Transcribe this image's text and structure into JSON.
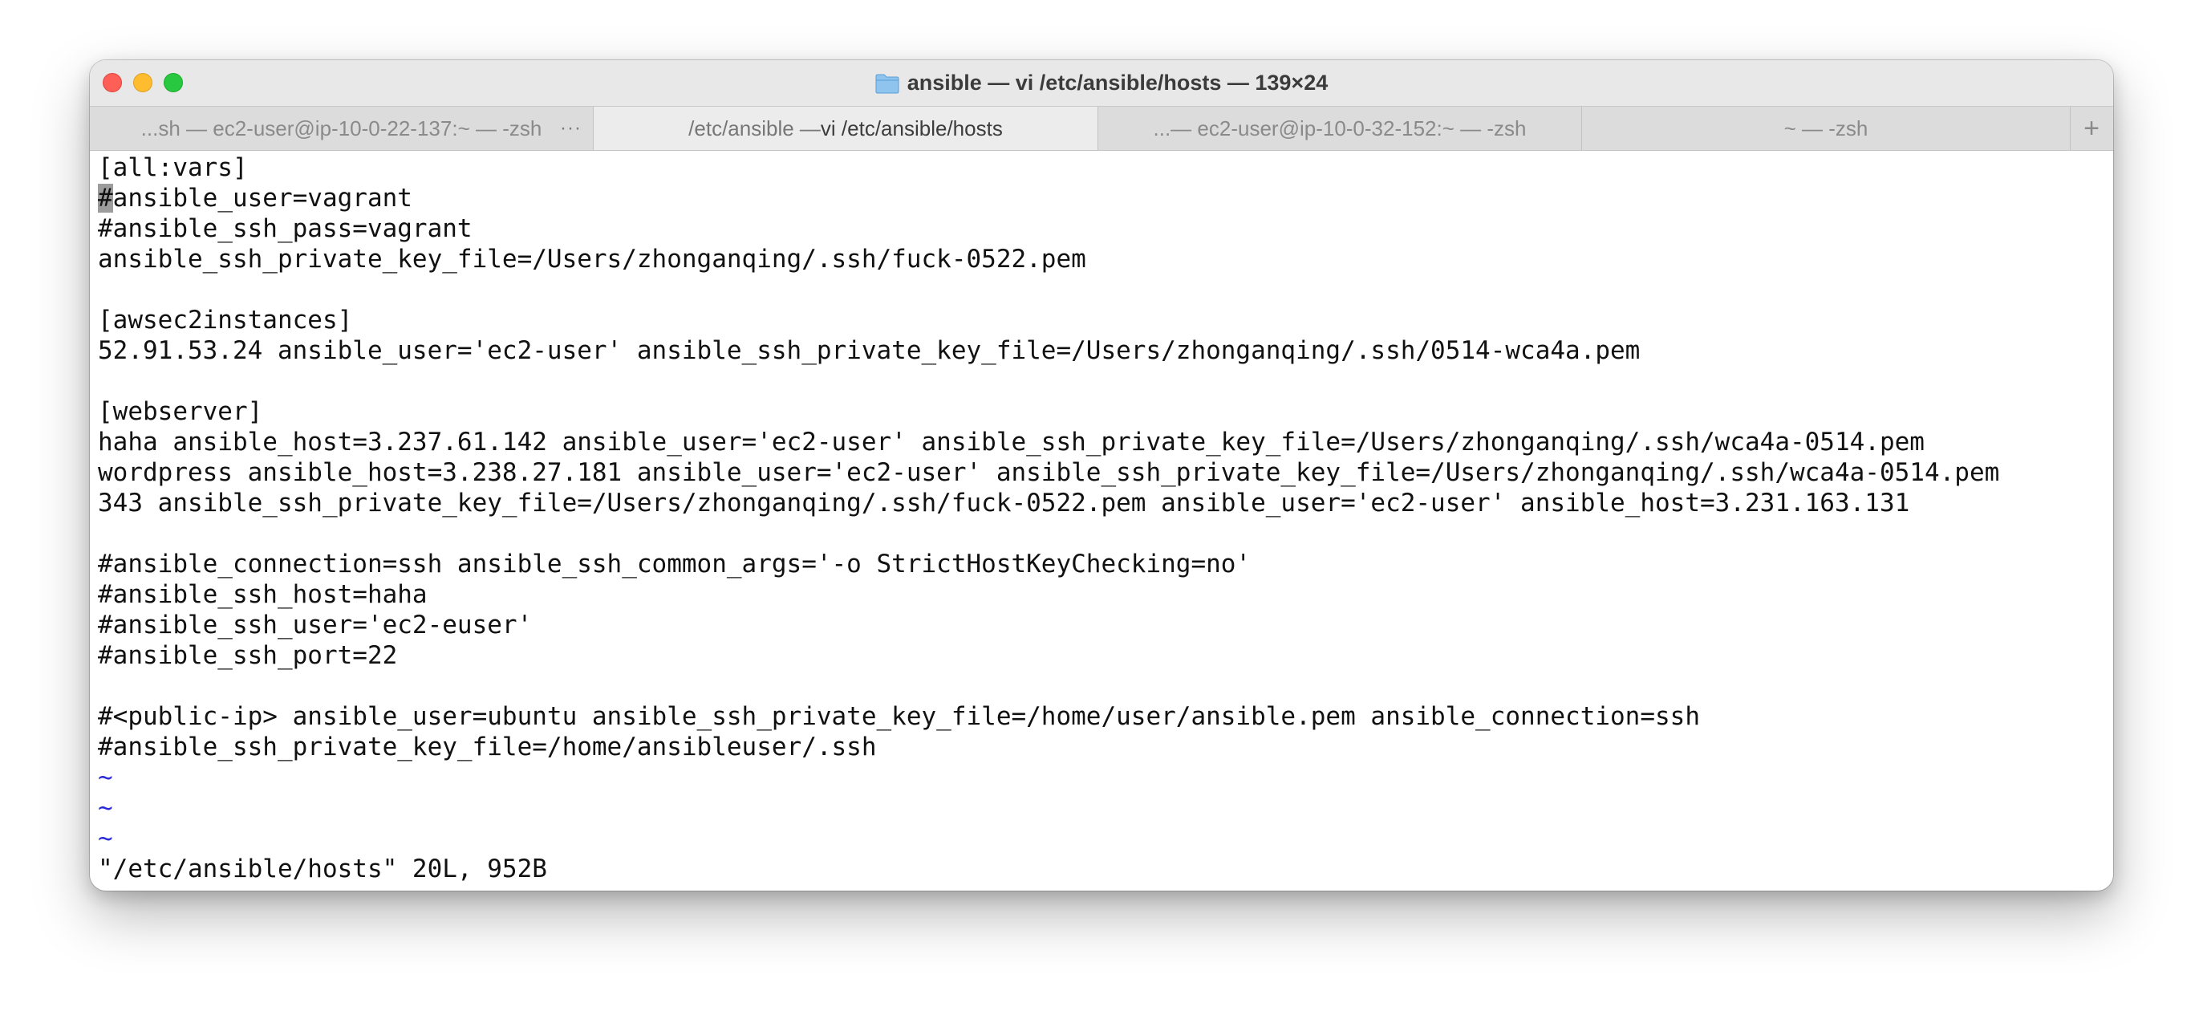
{
  "window": {
    "title": "ansible — vi /etc/ansible/hosts — 139×24"
  },
  "tabs": [
    {
      "label": "...sh — ec2-user@ip-10-0-22-137:~ — -zsh",
      "more": "···"
    },
    {
      "label_dim": "/etc/ansible — ",
      "label": "vi /etc/ansible/hosts"
    },
    {
      "label": "...— ec2-user@ip-10-0-32-152:~ — -zsh"
    },
    {
      "label": "~ — -zsh"
    }
  ],
  "new_tab_label": "+",
  "editor": {
    "cursor_char": "#",
    "first_line_rest": "ansible_user=vagrant",
    "lines": [
      "[all:vars]",
      "#ansible_user=vagrant",
      "#ansible_ssh_pass=vagrant",
      "ansible_ssh_private_key_file=/Users/zhonganqing/.ssh/fuck-0522.pem",
      "",
      "[awsec2instances]",
      "52.91.53.24 ansible_user='ec2-user' ansible_ssh_private_key_file=/Users/zhonganqing/.ssh/0514-wca4a.pem",
      "",
      "[webserver]",
      "haha ansible_host=3.237.61.142 ansible_user='ec2-user' ansible_ssh_private_key_file=/Users/zhonganqing/.ssh/wca4a-0514.pem",
      "wordpress ansible_host=3.238.27.181 ansible_user='ec2-user' ansible_ssh_private_key_file=/Users/zhonganqing/.ssh/wca4a-0514.pem",
      "343 ansible_ssh_private_key_file=/Users/zhonganqing/.ssh/fuck-0522.pem ansible_user='ec2-user' ansible_host=3.231.163.131",
      "",
      "#ansible_connection=ssh ansible_ssh_common_args='-o StrictHostKeyChecking=no'",
      "#ansible_ssh_host=haha",
      "#ansible_ssh_user='ec2-euser'",
      "#ansible_ssh_port=22",
      "",
      "#<public-ip> ansible_user=ubuntu ansible_ssh_private_key_file=/home/user/ansible.pem ansible_connection=ssh",
      "#ansible_ssh_private_key_file=/home/ansibleuser/.ssh"
    ],
    "tildes": [
      "~",
      "~",
      "~"
    ],
    "status_line": "\"/etc/ansible/hosts\" 20L, 952B"
  },
  "colors": {
    "tilde": "#2a2ad8",
    "cursor": "#9c9c9c",
    "close": "#fe5f57",
    "minimize": "#febc2e",
    "maximize": "#28c840"
  }
}
